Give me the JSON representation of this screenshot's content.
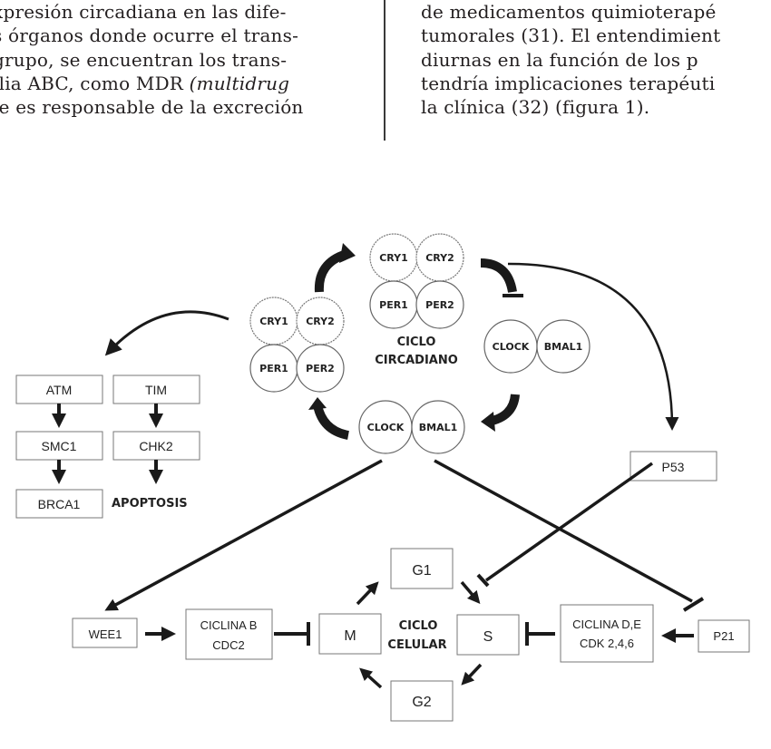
{
  "text": {
    "left_column": [
      "xpresión circadiana en las dife-",
      "s órganos donde ocurre el trans-",
      "grupo, se encuentran los trans-",
      "ilia ABC, como MDR",
      "ie es responsable de la excreción"
    ],
    "left_italic_fragment": "(multidrug",
    "right_column": [
      "de medicamentos quimioterapé",
      "tumorales (31). El entendimient",
      "diurnas en la función de los p",
      "tendría implicaciones terapéuti",
      "la clínica (32) (figura 1)."
    ]
  },
  "figure": {
    "circadian": {
      "title_line1": "CICLO",
      "title_line2": "CIRCADIANO",
      "top_complex": [
        "CRY1",
        "CRY2",
        "PER1",
        "PER2"
      ],
      "left_complex": [
        "CRY1",
        "CRY2",
        "PER1",
        "PER2"
      ],
      "right_dimer": [
        "CLOCK",
        "BMAL1"
      ],
      "bottom_dimer": [
        "CLOCK",
        "BMAL1"
      ]
    },
    "dna_repair": {
      "column1": [
        "ATM",
        "SMC1",
        "BRCA1"
      ],
      "column2": [
        "TIM",
        "CHK2"
      ],
      "apoptosis_label": "APOPTOSIS"
    },
    "p53": "P53",
    "cell_cycle": {
      "title_line1": "CICLO",
      "title_line2": "CELULAR",
      "phases": {
        "g1": "G1",
        "s": "S",
        "g2": "G2",
        "m": "M"
      }
    },
    "wee1": "WEE1",
    "cyclin_b": [
      "CICLINA B",
      "CDC2"
    ],
    "cyclin_d": [
      "CICLINA D,E",
      "CDK 2,4,6"
    ],
    "p21": "P21"
  }
}
